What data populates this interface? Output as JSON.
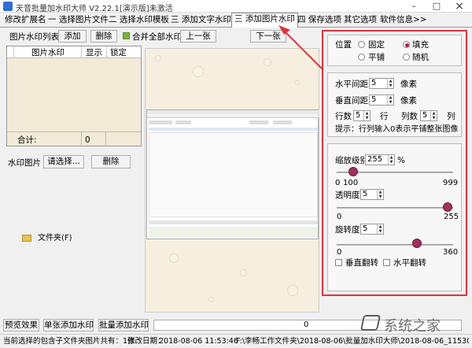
{
  "window": {
    "title": "天音批量加水印大师 V2.22.1[演示版]未激活",
    "min": "–",
    "max": "□",
    "close": "×"
  },
  "tabs": [
    "修改扩展名",
    "一 选择图片文件",
    "二 选择水印模板",
    "三 添加文字水印",
    "三 添加图片水印",
    "四 保存选项",
    "其它选项",
    "软件信息>>"
  ],
  "left": {
    "list_label": "图片水印列表",
    "add_btn": "添加",
    "delete_btn": "删除",
    "merge_label": "合并全部水印",
    "prev_btn": "上一张",
    "next_btn": "下一张",
    "columns": [
      "图片水印",
      "显示",
      "锁定"
    ],
    "total_label": "合计:",
    "total_value": "0",
    "wm_image_label": "水印图片",
    "select_btn": "请选择...",
    "wm_delete_btn": "删除",
    "folder_label": "文件夹(F)"
  },
  "right": {
    "position_label": "位置",
    "pos_options": {
      "fixed": "固定",
      "fill": "填充",
      "tile": "平铺",
      "random": "随机"
    },
    "h_spacing_label": "水平间距",
    "h_spacing": "5",
    "v_spacing_label": "垂直间距",
    "v_spacing": "5",
    "px_unit": "像素",
    "rows_label": "行数",
    "rows": "5",
    "rows_unit": "行",
    "cols_label": "列数",
    "cols": "5",
    "cols_unit": "列",
    "hint": "提示：行列输入0表示平铺整张图像",
    "scale_label": "缩放级别",
    "scale_value": "255",
    "scale_unit": "%",
    "scale_min": "0",
    "scale_mid": "100",
    "scale_max": "999",
    "opacity_label": "透明度",
    "opacity_value": "5",
    "opacity_min": "0",
    "opacity_max": "255",
    "rotate_label": "旋转度",
    "rotate_value": "5",
    "rotate_min": "0",
    "rotate_max": "360",
    "flip_v": "垂直翻转",
    "flip_h": "水平翻转"
  },
  "bottom": {
    "preview_btn": "预览效果",
    "single_btn": "单张添加水印",
    "batch_btn": "批量添加水印",
    "progress_text": "0"
  },
  "status": {
    "count_text": "当前选择的包含子文件夹图片共有：1张",
    "date_label": "修改日期：",
    "date_value": "2018-08-06 11:53:46",
    "path": "F:\\李畅工作文件夹\\2018-08-06\\批量加水印大师\\2018-08-06_115309.jpg"
  },
  "watermark_site": "系统之家"
}
